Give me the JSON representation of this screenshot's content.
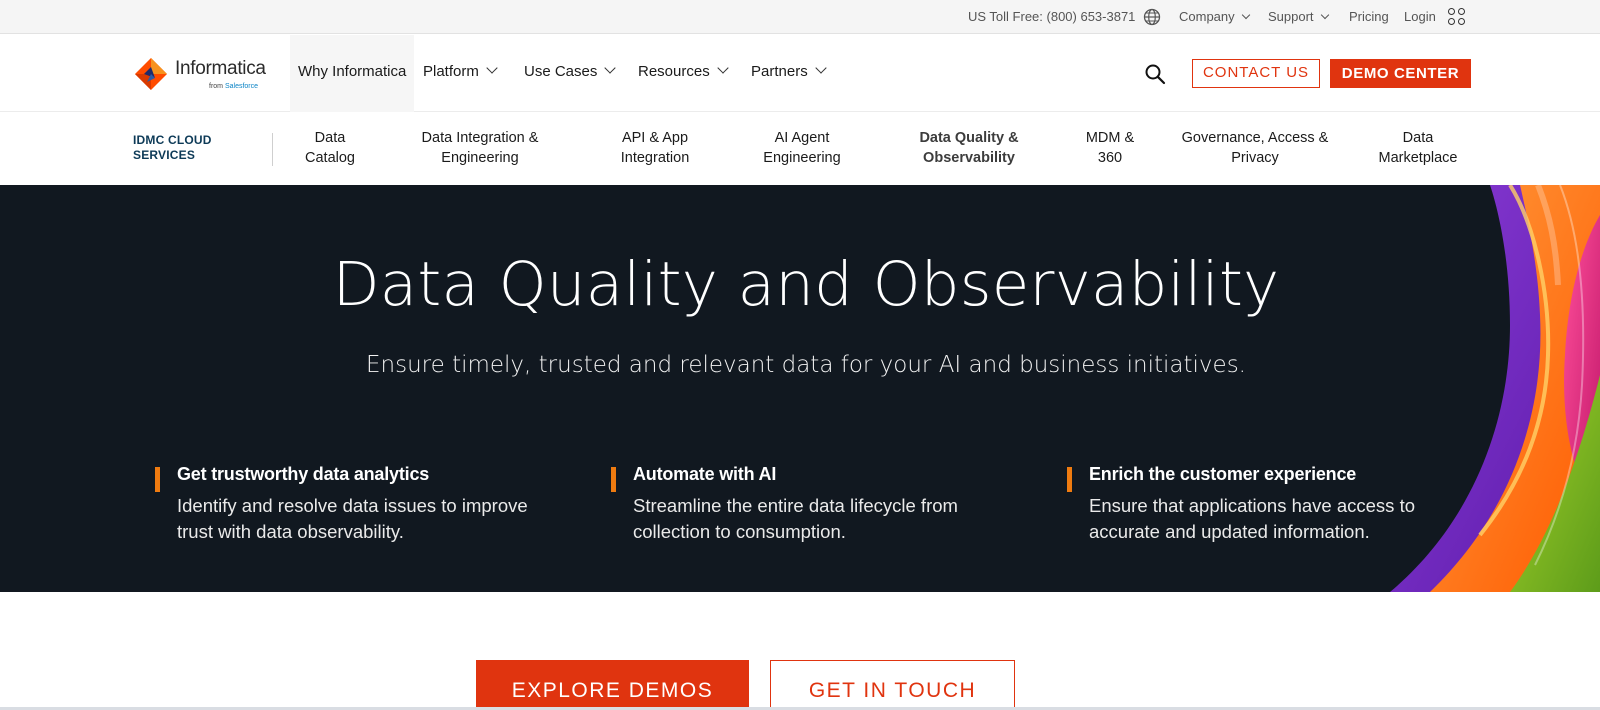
{
  "utility_bar": {
    "toll_free": "US Toll Free: (800) 653-3871",
    "company": "Company",
    "support": "Support",
    "pricing": "Pricing",
    "login": "Login",
    "icons": [
      "globe-icon",
      "apps-grid-icon"
    ]
  },
  "main_nav": {
    "logo_word": "Informatica",
    "logo_sub": "from",
    "logo_sub_brand": "Salesforce",
    "items": [
      {
        "label": "Why Informatica",
        "dropdown": false
      },
      {
        "label": "Platform",
        "dropdown": true
      },
      {
        "label": "Use Cases",
        "dropdown": true
      },
      {
        "label": "Resources",
        "dropdown": true
      },
      {
        "label": "Partners",
        "dropdown": true
      }
    ],
    "contact_label": "CONTACT US",
    "demo_label": "DEMO CENTER"
  },
  "sub_nav": {
    "title": "IDMC CLOUD SERVICES",
    "items": [
      {
        "line1": "Data",
        "line2": "Catalog"
      },
      {
        "line1": "Data Integration &",
        "line2": "Engineering"
      },
      {
        "line1": "API & App",
        "line2": "Integration"
      },
      {
        "line1": "AI Agent",
        "line2": "Engineering"
      },
      {
        "line1": "Data Quality &",
        "line2": "Observability"
      },
      {
        "line1": "MDM &",
        "line2": "360"
      },
      {
        "line1": "Governance, Access &",
        "line2": "Privacy"
      },
      {
        "line1": "Data",
        "line2": "Marketplace"
      }
    ]
  },
  "hero": {
    "title": "Data Quality and Observability",
    "subtitle": "Ensure timely, trusted and relevant data for your AI and business initiatives.",
    "features": [
      {
        "title": "Get trustworthy data analytics",
        "line1": "Identify and resolve data issues to improve",
        "line2": "trust with data observability."
      },
      {
        "title": "Automate with AI",
        "line1": "Streamline the entire data lifecycle from",
        "line2": "collection to consumption."
      },
      {
        "title": "Enrich the customer experience",
        "line1": "Ensure that applications have access to",
        "line2": "accurate and updated information."
      }
    ]
  },
  "cta": {
    "explore": "EXPLORE DEMOS",
    "touch": "GET IN TOUCH"
  },
  "colors": {
    "accent": "#e0340f",
    "hero_bg": "#111820",
    "feature_bar": "#ef7b10",
    "sub_title": "#0d3a57"
  }
}
